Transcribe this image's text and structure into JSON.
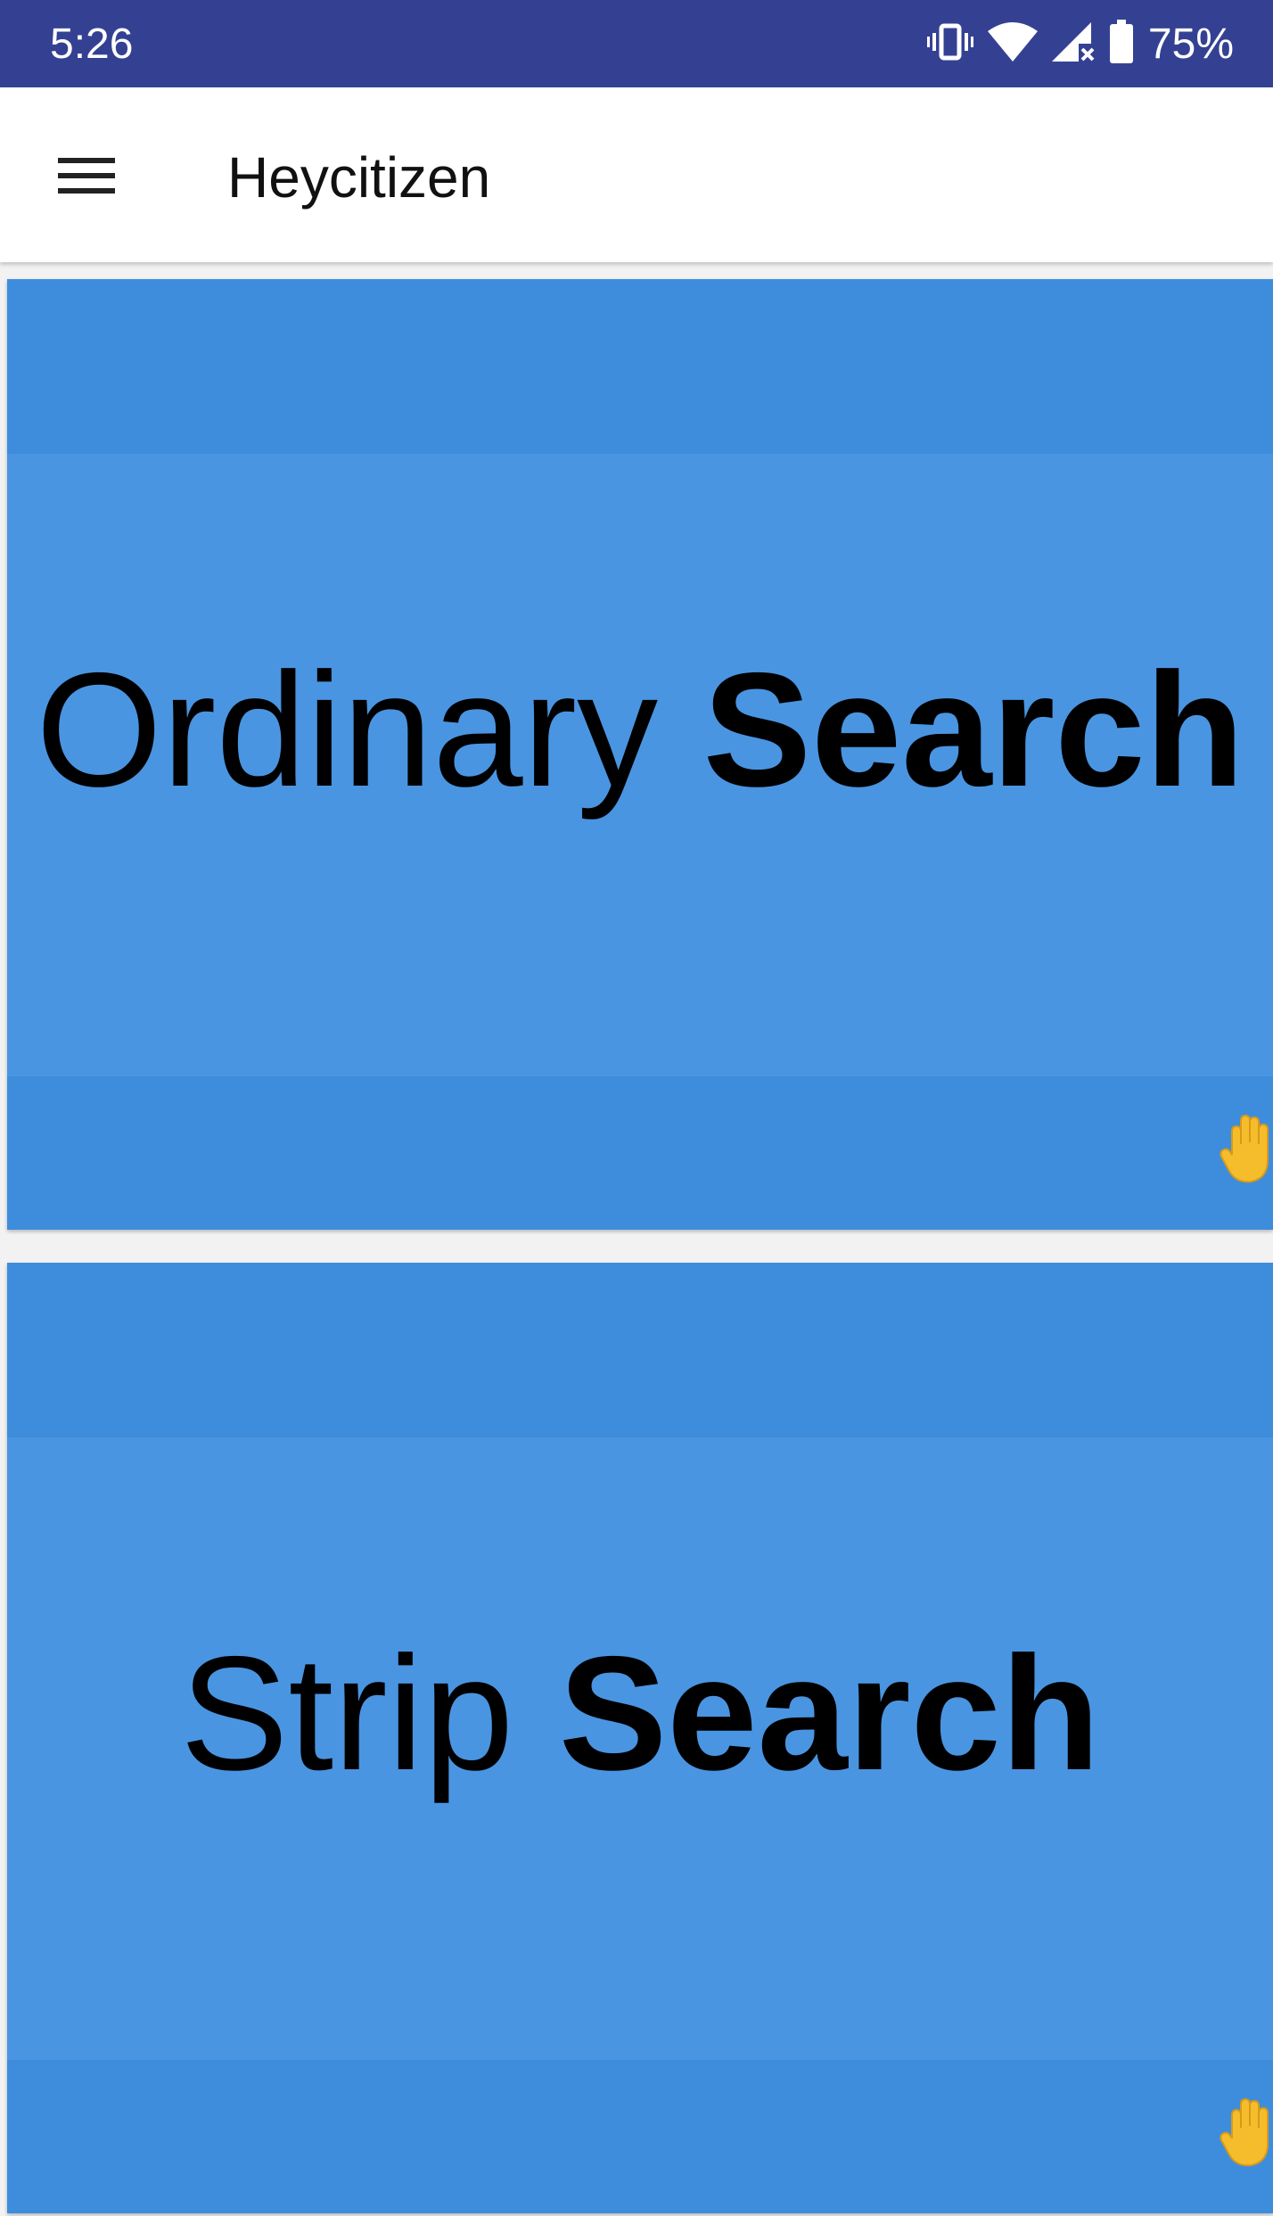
{
  "status_bar": {
    "time": "5:26",
    "battery_percent": "75%",
    "icons": [
      "vibrate-icon",
      "wifi-icon",
      "signal-icon",
      "battery-icon"
    ],
    "background": "#344193"
  },
  "app_bar": {
    "title": "Heycitizen",
    "menu_icon": "hamburger-menu-icon"
  },
  "cards": [
    {
      "title_regular": "Ordinary",
      "title_bold": "Search",
      "icon": "raised-hand-icon"
    },
    {
      "title_regular": "Strip",
      "title_bold": "Search",
      "icon": "raised-hand-icon"
    }
  ],
  "colors": {
    "card_background": "#4a95e1",
    "card_band": "#3d8ddc",
    "hand_icon": "#f5bd2c"
  }
}
